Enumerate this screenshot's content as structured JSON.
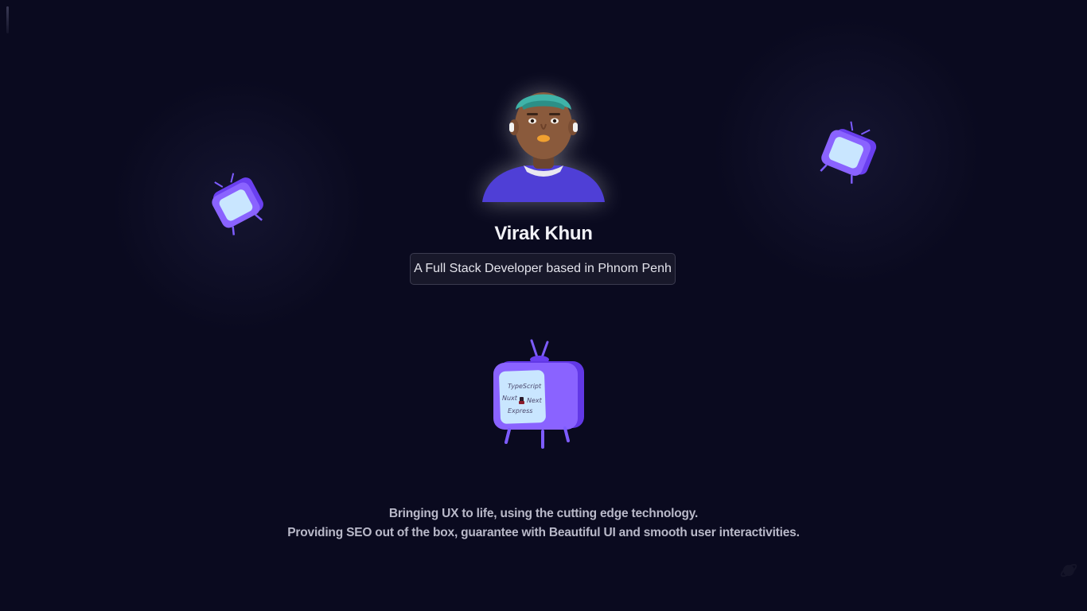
{
  "profile": {
    "name": "Virak Khun",
    "tagline": "A Full Stack Developer based in Phnom Penh"
  },
  "tv_screen": {
    "line1": "TypeScript",
    "line2_left": "Nuxt",
    "line2_right": "Next",
    "line3": "Express"
  },
  "description": {
    "line1": "Bringing UX to life, using the cutting edge technology.",
    "line2": "Providing SEO out of the box, guarantee with Beautiful UI and smooth user interactivities."
  },
  "theme": {
    "background": "#0a0a1f",
    "accent": "#7b4dff",
    "screen": "#bfe3ff"
  },
  "icons": {
    "theme_toggle": "planet-icon"
  }
}
